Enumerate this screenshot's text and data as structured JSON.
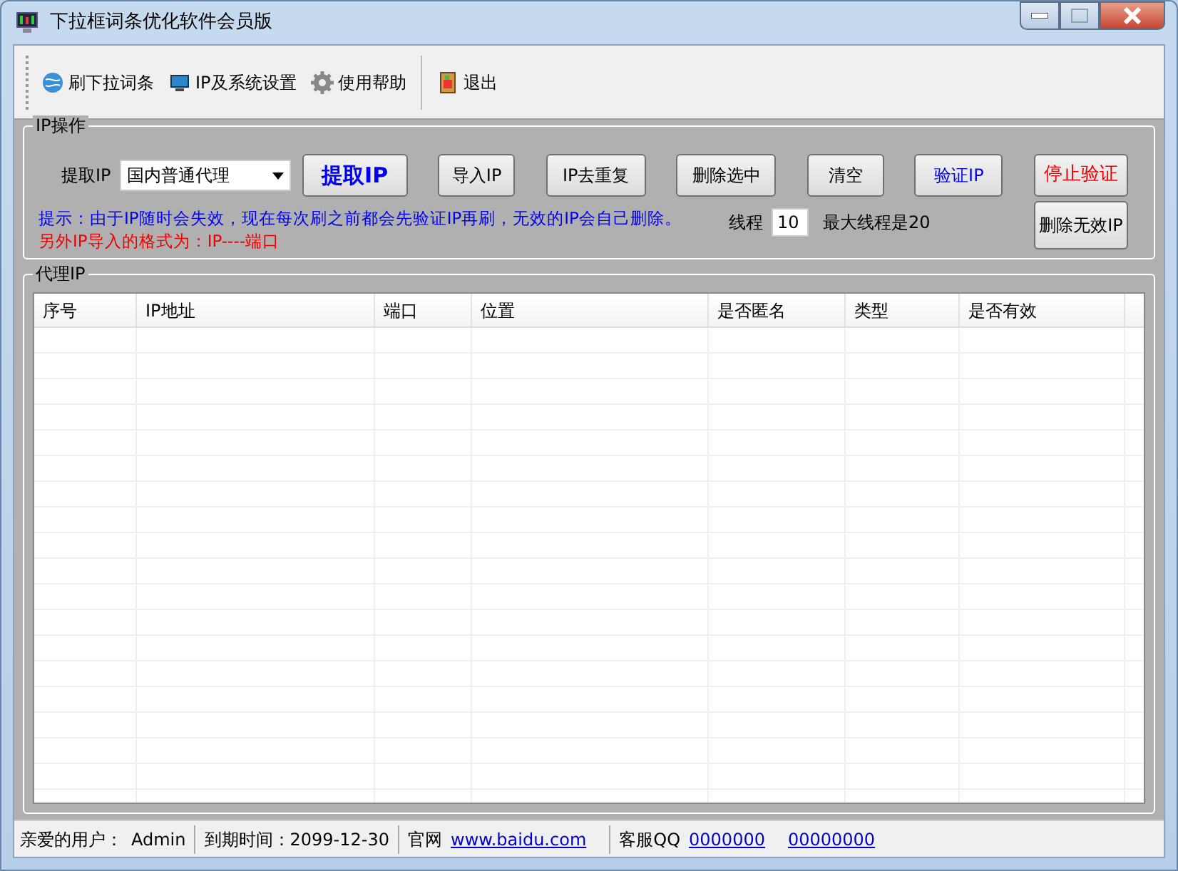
{
  "window": {
    "title": "下拉框词条优化软件会员版"
  },
  "toolbar": [
    {
      "items": [
        "刷下拉词条",
        "IP及系统设置",
        "使用帮助"
      ]
    },
    {
      "items": [
        "退出"
      ]
    }
  ],
  "ip_group": {
    "title": "IP操作",
    "extract_label": "提取IP",
    "proxy_type": "国内普通代理",
    "buttons": [
      {
        "label": "提取IP",
        "kind": "primary"
      },
      {
        "label": "导入IP",
        "kind": "plain"
      },
      {
        "label": "IP去重复",
        "kind": "plain"
      },
      {
        "label": "删除选中",
        "kind": "plain"
      },
      {
        "label": "清空",
        "kind": "plain"
      },
      {
        "label": "验证IP",
        "kind": "blue"
      },
      {
        "label": "停止验证",
        "kind": "red"
      }
    ],
    "notes": [
      {
        "text": "提示：由于IP随时会失效，现在每次刷之前都会先验证IP再刷，无效的IP会自己删除。",
        "kind": "tip"
      },
      {
        "text": "另外IP导入的格式为：IP----端口",
        "kind": "warning"
      }
    ],
    "thread_label": "线程",
    "thread_value": "10",
    "thread_max": "最大线程是20",
    "delete_invalid": "删除无效IP"
  },
  "proxy_group": {
    "title": "代理IP",
    "columns": [
      "序号",
      "IP地址",
      "端口",
      "位置",
      "是否匿名",
      "类型",
      "是否有效"
    ]
  },
  "status_bar": [
    {
      "items": [
        {
          "text": "亲爱的用户：",
          "kind": "text"
        },
        {
          "text": "Admin",
          "kind": "text"
        }
      ]
    },
    {
      "items": [
        {
          "text": "到期时间：2099-12-30",
          "kind": "text"
        }
      ]
    },
    {
      "items": [
        {
          "text": "官网",
          "kind": "text"
        },
        {
          "text": "www.baidu.com",
          "kind": "link"
        }
      ]
    },
    {
      "items": [
        {
          "text": "客服QQ",
          "kind": "text"
        },
        {
          "text": "0000000",
          "kind": "link"
        },
        {
          "text": "00000000",
          "kind": "link"
        }
      ]
    }
  ]
}
